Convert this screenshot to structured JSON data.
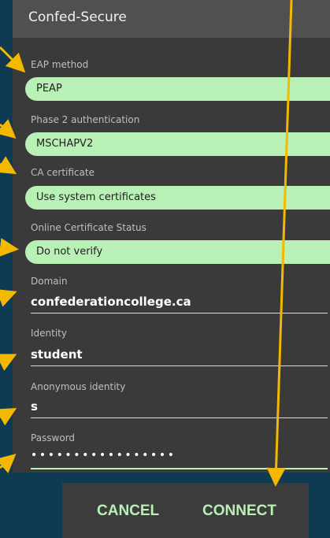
{
  "dialog": {
    "title": "Confed-Secure"
  },
  "fields": {
    "eap_method": {
      "label": "EAP method",
      "value": "PEAP"
    },
    "phase2": {
      "label": "Phase 2 authentication",
      "value": "MSCHAPV2"
    },
    "ca_cert": {
      "label": "CA certificate",
      "value": "Use system certificates"
    },
    "ocsp": {
      "label": "Online Certificate Status",
      "value": "Do not verify"
    },
    "domain": {
      "label": "Domain",
      "value": "confederationcollege.ca"
    },
    "identity": {
      "label": "Identity",
      "value": "student"
    },
    "anon_identity": {
      "label": "Anonymous identity",
      "value": "s"
    },
    "password": {
      "label": "Password",
      "value": "•••••••••••••••••"
    }
  },
  "buttons": {
    "cancel": "CANCEL",
    "connect": "CONNECT"
  },
  "colors": {
    "background": "#0e3a52",
    "dialog": "#3a3a3a",
    "spinner": "#b8f0b6",
    "accent": "#b8f0b6",
    "arrow": "#f5b800"
  }
}
